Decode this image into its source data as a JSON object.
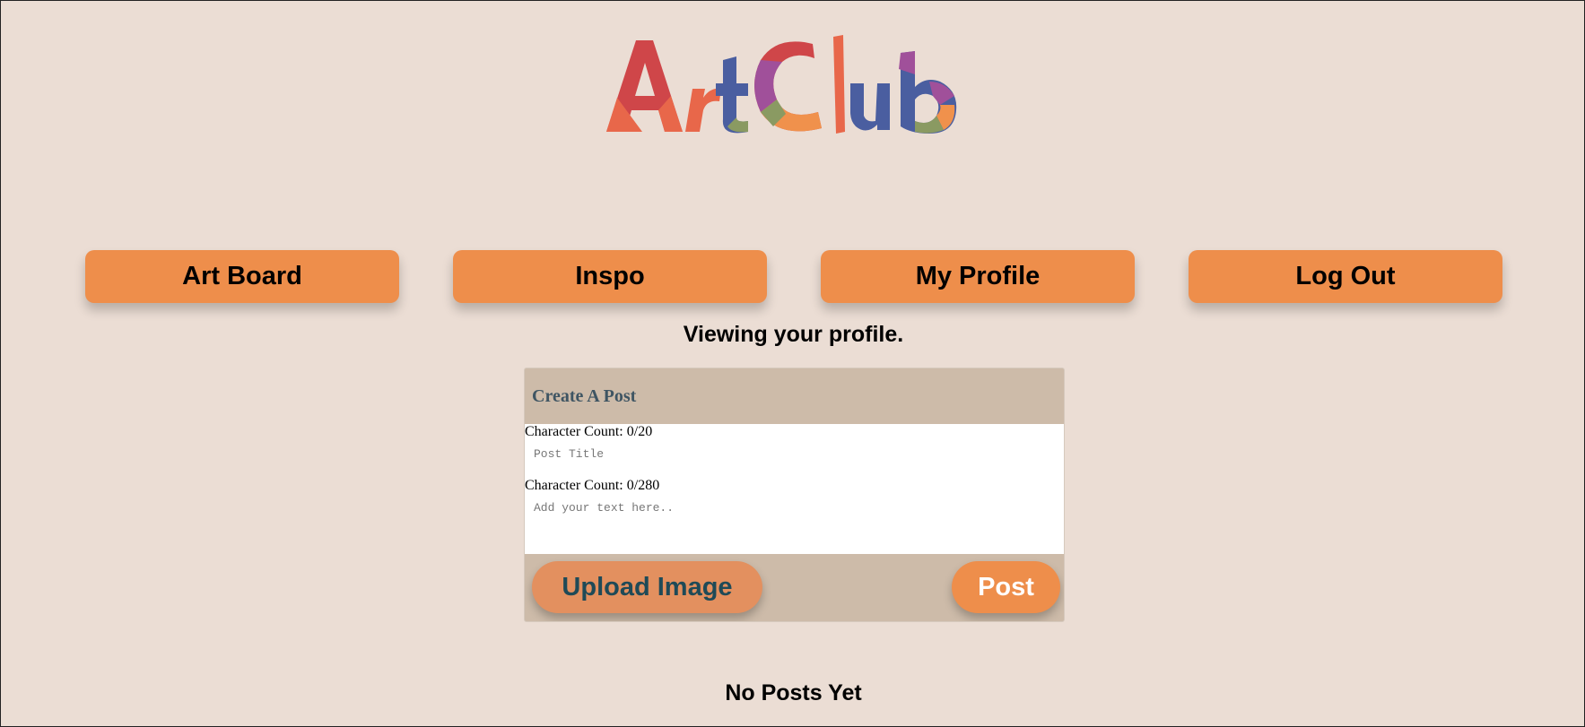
{
  "logo": {
    "text": "ArtClub",
    "colors": [
      "#cf4649",
      "#e8674a",
      "#4a5ea0",
      "#a0509a",
      "#8a9a62",
      "#f0914c"
    ]
  },
  "nav": {
    "items": [
      {
        "label": "Art Board"
      },
      {
        "label": "Inspo"
      },
      {
        "label": "My Profile"
      },
      {
        "label": "Log Out"
      }
    ]
  },
  "status_text": "Viewing your profile.",
  "create_post": {
    "title": "Create A Post",
    "title_count": "Character Count: 0/20",
    "title_placeholder": "Post Title",
    "body_count": "Character Count: 0/280",
    "body_placeholder": "Add your text here..",
    "upload_label": "Upload Image",
    "post_label": "Post"
  },
  "empty_state": "No Posts Yet",
  "colors": {
    "background": "#ebddd4",
    "nav_button": "#ee8e4b",
    "card": "#cdbba9",
    "upload_button": "#e3905f",
    "header_text": "#3f5563"
  }
}
